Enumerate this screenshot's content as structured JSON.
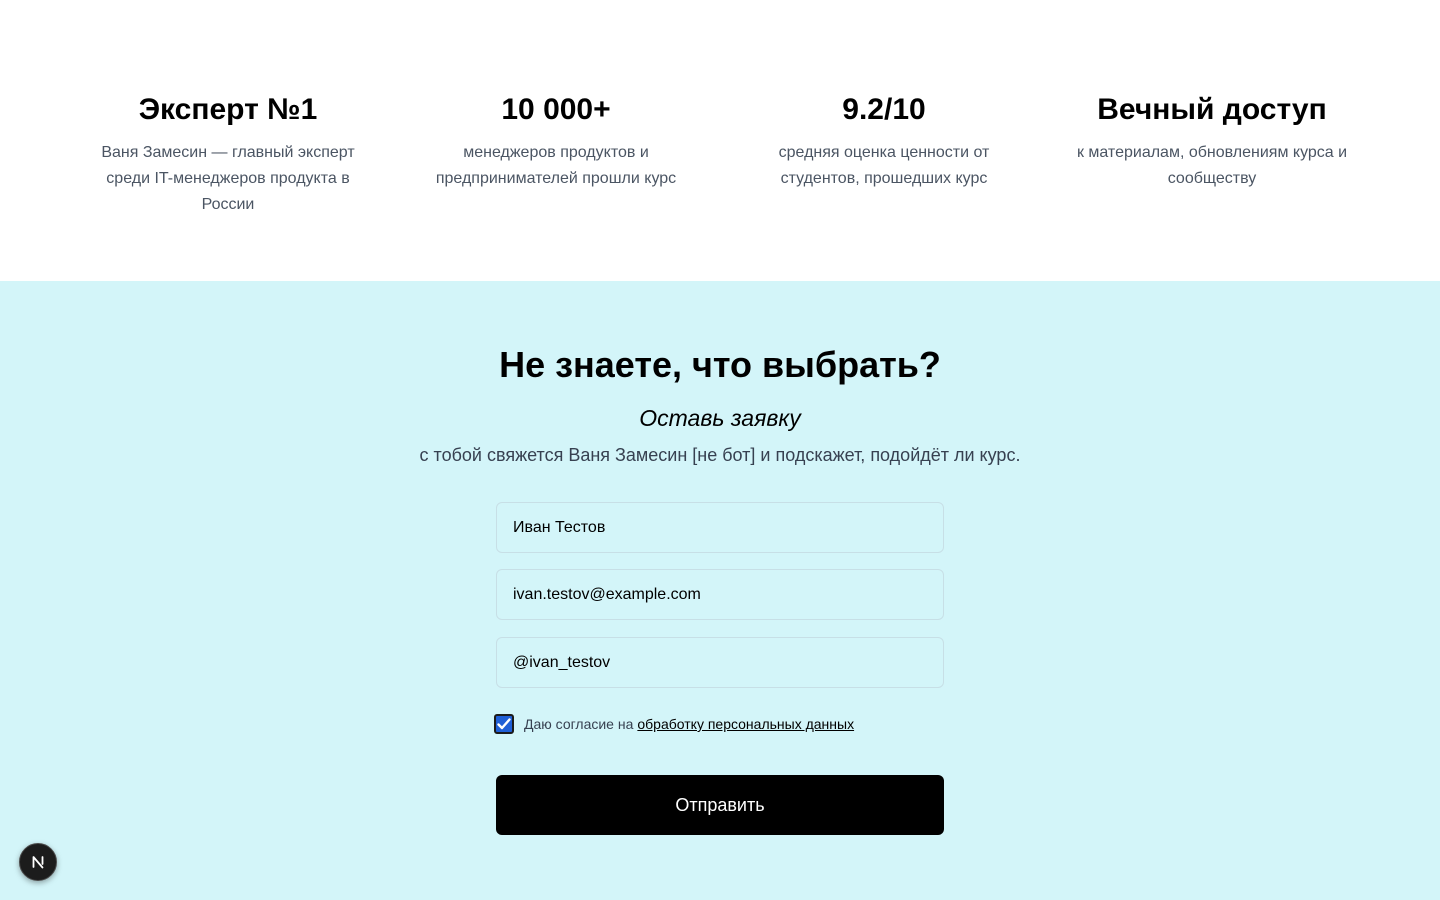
{
  "stats": [
    {
      "title": "Эксперт №1",
      "description": "Ваня Замесин — главный эксперт среди IT-менеджеров продукта в России"
    },
    {
      "title": "10 000+",
      "description": "менеджеров продуктов и предпринимателей прошли курс"
    },
    {
      "title": "9.2/10",
      "description": "средняя оценка ценности от студентов, прошедших курс"
    },
    {
      "title": "Вечный доступ",
      "description": "к материалам, обновлениям курса и сообществу"
    }
  ],
  "form_section": {
    "title": "Не знаете, что выбрать?",
    "subtitle": "Оставь заявку",
    "note": "с тобой свяжется Ваня Замесин [не бот] и подскажет, подойдёт ли курс.",
    "name_value": "Иван Тестов",
    "email_value": "ivan.testov@example.com",
    "telegram_value": "@ivan_testov",
    "consent_checked": true,
    "consent_text": "Даю согласие на",
    "consent_link": "обработку персональных данных",
    "submit_label": "Отправить"
  },
  "colors": {
    "section_background": "#d3f5f9",
    "button_background": "#000000",
    "checkbox_fill": "#1f5fd6"
  },
  "icons": {
    "checkbox": "checkmark-icon",
    "dev_badge": "nextjs-logo-icon"
  }
}
